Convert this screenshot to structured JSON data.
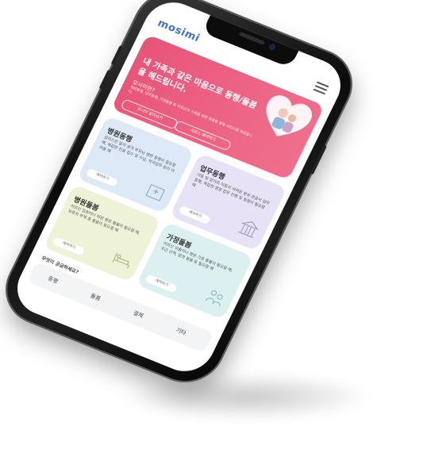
{
  "app": {
    "logo": "mosimi"
  },
  "hero": {
    "title": "내 가족과 같은 마음으로 동행/돌봄을 해드립니다.",
    "question": "모시미란?",
    "description": "병원동행, 업무동행, 가정돌봄 등 어르신과 가족을 위한 맞춤형 동행 서비스를 제공합니다.",
    "button1": "모시미 알아보기",
    "button2": "서비스 예약하기"
  },
  "cards": [
    {
      "title": "병원동행",
      "desc": "갑작스런 일이 생겨 부모님 병원 동행이 필요할 때, 복잡한 진료 접수 및 수납, 약국업무 등이 어려울 때",
      "button": "예약하기",
      "icon": "hospital-icon"
    },
    {
      "title": "업무동행",
      "desc": "거동 및 장거리 이동이 어려운 분의 관공서 업무 동행, 복잡한 행정 업무 진행 및 동행이 필요할 때",
      "button": "예약하기",
      "icon": "building-icon"
    },
    {
      "title": "병원돌봄",
      "desc": "어르신 입원이나 퇴원 병원 돌봄이 필요할 때, 보호자 부재 중 돌봄이 필요할 때",
      "button": "예약하기",
      "icon": "bed-icon"
    },
    {
      "title": "가정돌봄",
      "desc": "어르신 외출이나 병원 가정 돌봄이 필요할 때, 주간 산책, 말벗 돌봄 등 필요할 때",
      "button": "예약하기",
      "icon": "home-care-icon"
    }
  ],
  "tabs": {
    "title": "무엇이 궁금하세요?",
    "items": [
      "동행",
      "돌봄",
      "결제",
      "기타"
    ]
  }
}
